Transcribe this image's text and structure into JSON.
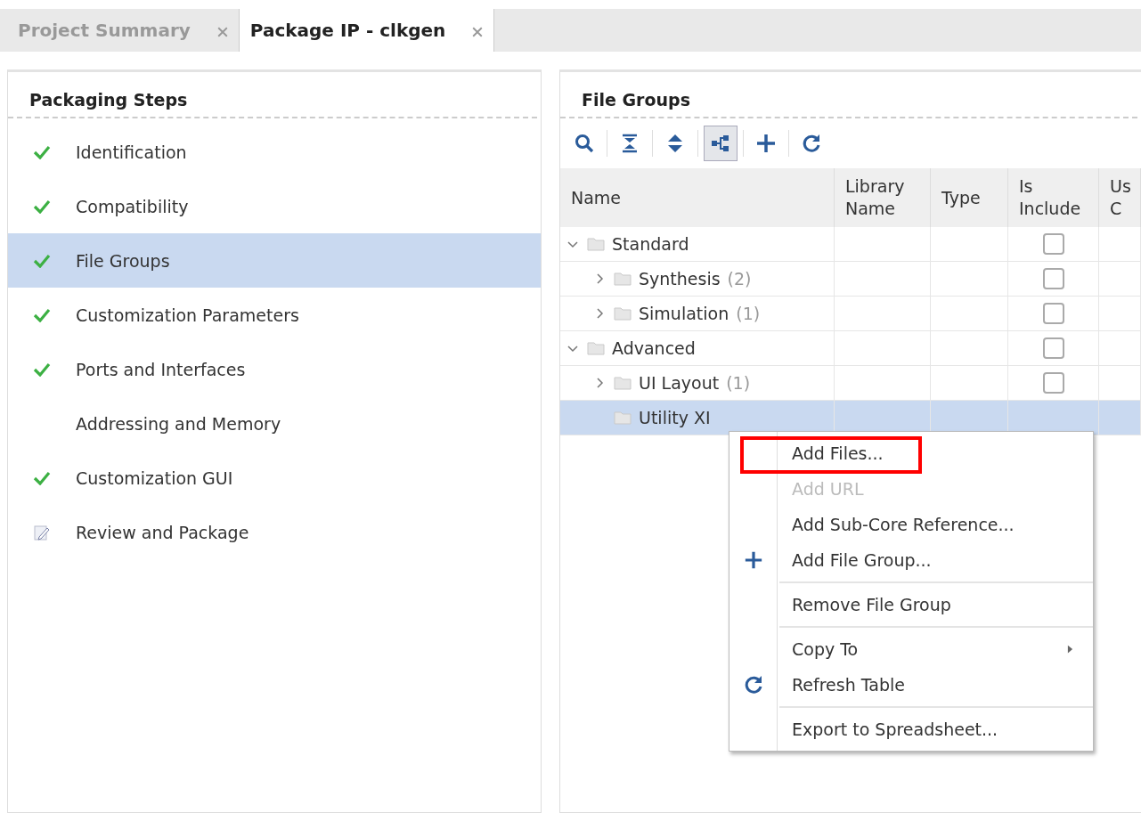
{
  "tabs": [
    {
      "label": "Project Summary",
      "selected": false
    },
    {
      "label": "Package IP - clkgen",
      "selected": true
    }
  ],
  "steps_panel": {
    "title": "Packaging Steps",
    "items": [
      {
        "label": "Identification",
        "kind": "done",
        "selected": false
      },
      {
        "label": "Compatibility",
        "kind": "done",
        "selected": false
      },
      {
        "label": "File Groups",
        "kind": "done",
        "selected": true
      },
      {
        "label": "Customization Parameters",
        "kind": "done",
        "selected": false
      },
      {
        "label": "Ports and Interfaces",
        "kind": "done",
        "selected": false
      },
      {
        "label": "Addressing and Memory",
        "kind": "none",
        "selected": false
      },
      {
        "label": "Customization GUI",
        "kind": "done",
        "selected": false
      },
      {
        "label": "Review and Package",
        "kind": "edit",
        "selected": false
      }
    ]
  },
  "file_groups": {
    "title": "File Groups",
    "toolbar": [
      {
        "kind": "search",
        "pressed": false
      },
      {
        "kind": "collapse",
        "pressed": false
      },
      {
        "kind": "expand",
        "pressed": false
      },
      {
        "kind": "hierarchy",
        "pressed": true
      },
      {
        "kind": "add",
        "pressed": false
      },
      {
        "kind": "refresh",
        "pressed": false
      }
    ],
    "columns": [
      [
        "Name"
      ],
      [
        "Library",
        "Name"
      ],
      [
        "Type"
      ],
      [
        "Is",
        "Include"
      ],
      [
        "Us",
        "C"
      ]
    ],
    "rows": [
      {
        "name": "Standard",
        "expanded": true,
        "selected": false,
        "included": false,
        "children": [
          {
            "name": "Synthesis",
            "count": "(2)",
            "expanded": false,
            "selected": false,
            "included": false
          },
          {
            "name": "Simulation",
            "count": "(1)",
            "expanded": false,
            "selected": false,
            "included": false
          }
        ]
      },
      {
        "name": "Advanced",
        "expanded": true,
        "selected": false,
        "included": false,
        "children": [
          {
            "name": "UI Layout",
            "count": "(1)",
            "expanded": false,
            "selected": false,
            "included": false
          },
          {
            "name": "Utility XI",
            "selected": true
          }
        ]
      }
    ]
  },
  "context_menu": [
    {
      "kind": "item",
      "label": "Add Files...",
      "disabled": false,
      "highlighted": true
    },
    {
      "kind": "item",
      "label": "Add URL",
      "disabled": true,
      "highlighted": false
    },
    {
      "kind": "item",
      "label": "Add Sub-Core Reference...",
      "disabled": false,
      "highlighted": false
    },
    {
      "kind": "add",
      "label": "Add File Group...",
      "disabled": false,
      "highlighted": false
    },
    {
      "kind": "separator"
    },
    {
      "kind": "item",
      "label": "Remove File Group",
      "disabled": false,
      "highlighted": false
    },
    {
      "kind": "separator"
    },
    {
      "kind": "item",
      "label": "Copy To",
      "submenu": true,
      "disabled": false,
      "highlighted": false
    },
    {
      "kind": "refresh",
      "label": "Refresh Table",
      "disabled": false,
      "highlighted": false
    },
    {
      "kind": "separator"
    },
    {
      "kind": "item",
      "label": "Export to Spreadsheet...",
      "disabled": false,
      "highlighted": false
    }
  ]
}
